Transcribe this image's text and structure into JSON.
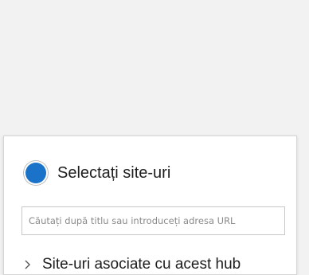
{
  "selection": {
    "radio_label": "Selectați site-uri",
    "selected": true,
    "accent_color": "#1a73c9"
  },
  "search": {
    "value": "",
    "placeholder": "Căutați după titlu sau introduceți adresa URL"
  },
  "associated": {
    "label": "Site-uri asociate cu acest hub",
    "icon": "chevron-right-icon"
  }
}
